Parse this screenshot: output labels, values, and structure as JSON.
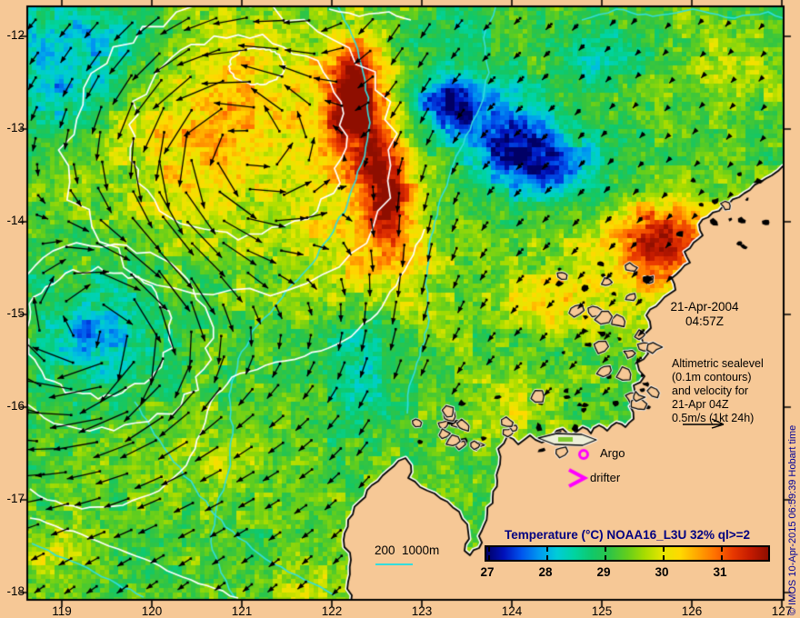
{
  "map": {
    "timestamp": {
      "line1": "21-Apr-2004",
      "line2": "04:57Z"
    },
    "note": {
      "lines": [
        "Altimetric sealevel",
        "(0.1m contours)",
        "and velocity for",
        "21-Apr 04Z",
        "0.5m/s (1kt 24h)"
      ]
    },
    "markers": {
      "argo_label": "Argo",
      "drifter_label": "drifter",
      "color": "#FF00FF"
    },
    "bathy_legend": {
      "label": "200  1000m",
      "line_color": "#33DDDD"
    },
    "axes": {
      "x_ticks": [
        "119",
        "120",
        "121",
        "122",
        "123",
        "124",
        "125",
        "126",
        "127"
      ],
      "y_ticks": [
        "-12",
        "-13",
        "-14",
        "-15",
        "-16",
        "-17",
        "-18"
      ]
    },
    "colorbar": {
      "title": "Temperature (°C) NOAA16_L3U 32% ql>=2",
      "ticks": [
        "27",
        "28",
        "29",
        "30",
        "31"
      ],
      "title_color": "#000080",
      "range_c": [
        27,
        31.9
      ],
      "gradient": [
        "#000066",
        "#0011BB",
        "#0055EE",
        "#0099F0",
        "#00CCD8",
        "#00D4A0",
        "#10C86A",
        "#2EC446",
        "#63CE1C",
        "#A8DC00",
        "#E6E600",
        "#FFD900",
        "#FFA500",
        "#FF7000",
        "#E83800",
        "#C41A00",
        "#8F0E00"
      ]
    },
    "credit": {
      "text": "© IMOS 10-Apr-2015 06:59:39 Hobart time",
      "color": "#000099"
    },
    "colors": {
      "land": "#F6C896",
      "ssh_contour": "#FFFFFF",
      "bathy_contour": "#33DDDD",
      "arrow": "#000000"
    }
  }
}
